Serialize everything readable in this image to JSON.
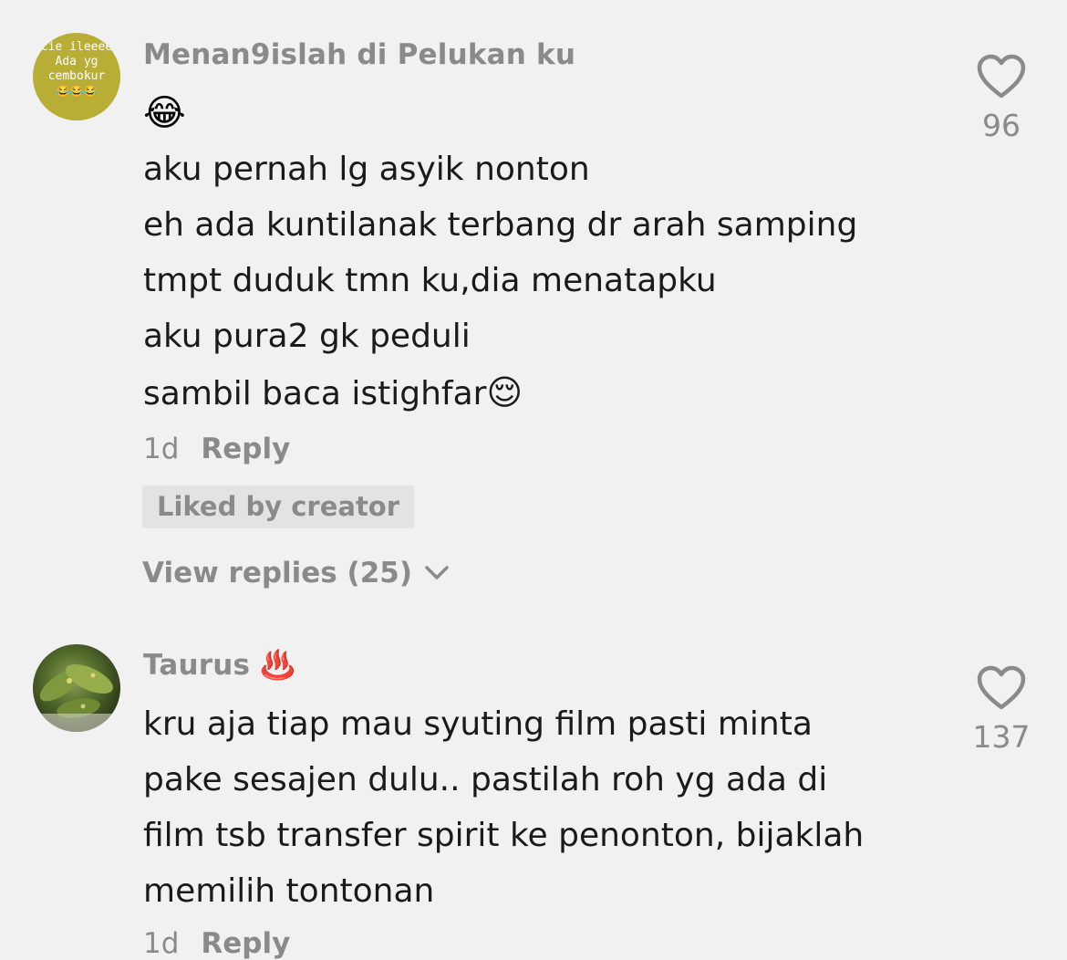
{
  "comments": [
    {
      "avatar_text": [
        "cie ileeee",
        "Ada yg",
        "cembokur"
      ],
      "avatar_emoji": "😂😂😂",
      "username": "Menan9islah di Pelukan ku",
      "emoji_line": "😂",
      "lines": [
        "aku pernah lg asyik nonton",
        "eh ada kuntilanak terbang dr arah samping",
        "tmpt duduk tmn ku,dia menatapku",
        "aku pura2 gk peduli",
        "sambil baca istighfar"
      ],
      "last_line_emoji": "😌",
      "time": "1d",
      "reply_label": "Reply",
      "liked_by_creator": "Liked by creator",
      "view_replies": "View replies (25)",
      "like_count": "96",
      "like_icon": "heart-outline-icon"
    },
    {
      "username": "Taurus",
      "username_emoji": "♨️",
      "lines": [
        "kru aja tiap mau syuting film pasti minta",
        "pake sesajen dulu.. pastilah roh yg ada di",
        "film tsb transfer spirit ke penonton, bijaklah",
        "memilih tontonan"
      ],
      "time": "1d",
      "reply_label": "Reply",
      "like_count": "137",
      "like_icon": "heart-outline-icon"
    }
  ],
  "colors": {
    "background": "#f1f1f1",
    "secondary_text": "#8a8a8a",
    "primary_text": "#1a1a1a",
    "badge_bg": "#e3e3e3"
  }
}
